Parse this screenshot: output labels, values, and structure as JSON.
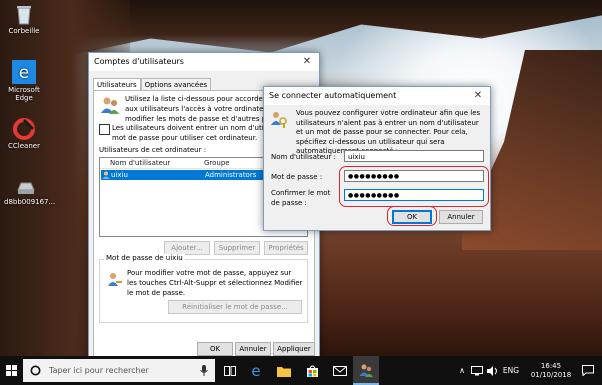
{
  "desktop_icons": [
    {
      "label": "Corbeille",
      "icon": "recycle-bin-icon"
    },
    {
      "label": "Microsoft Edge",
      "icon": "edge-icon"
    },
    {
      "label": "CCleaner",
      "icon": "ccleaner-icon"
    },
    {
      "label": "d8bb009167...",
      "icon": "drive-icon"
    }
  ],
  "accounts_window": {
    "title": "Comptes d'utilisateurs",
    "tabs": [
      "Utilisateurs",
      "Options avancées"
    ],
    "intro": "Utilisez la liste ci-dessous pour accorder ou refuser aux utilisateurs l'accès à votre ordinateur, et pour modifier les mots de passe et d'autres paramètres.",
    "checkbox_label": "Les utilisateurs doivent entrer un nom d'utilisateur et un mot de passe pour utiliser cet ordinateur.",
    "users_section": "Utilisateurs de cet ordinateur :",
    "columns": [
      "Nom d'utilisateur",
      "Groupe"
    ],
    "rows": [
      {
        "name": "uixiu",
        "group": "Administrators"
      }
    ],
    "btn_add": "Ajouter...",
    "btn_remove": "Supprimer",
    "btn_props": "Propriétés",
    "pwd_section": "Mot de passe de uixiu",
    "pwd_text": "Pour modifier votre mot de passe, appuyez sur les touches Ctrl-Alt-Suppr et sélectionnez Modifier le mot de passe.",
    "btn_reset": "Réinitialiser le mot de passe...",
    "btn_ok": "OK",
    "btn_cancel": "Annuler",
    "btn_apply": "Appliquer"
  },
  "autologon_dialog": {
    "title": "Se connecter automatiquement",
    "text": "Vous pouvez configurer votre ordinateur afin que les utilisateurs n'aient pas à entrer un nom d'utilisateur et un mot de passe pour se connecter. Pour cela, spécifiez ci-dessous un utilisateur qui sera automatiquement connecté :",
    "user_label": "Nom d'utilisateur :",
    "user_value": "uixiu",
    "pwd_label": "Mot de passe :",
    "pwd_value": "●●●●●●●●●",
    "confirm_label": "Confirmer le mot de passe :",
    "confirm_value": "●●●●●●●●●",
    "btn_ok": "OK",
    "btn_cancel": "Annuler"
  },
  "taskbar": {
    "search_placeholder": "Taper ici pour rechercher",
    "lang": "ENG",
    "time": "16:45",
    "date": "01/10/2018"
  },
  "colors": {
    "accent": "#0078d7",
    "highlight_ring": "#d9272e"
  }
}
